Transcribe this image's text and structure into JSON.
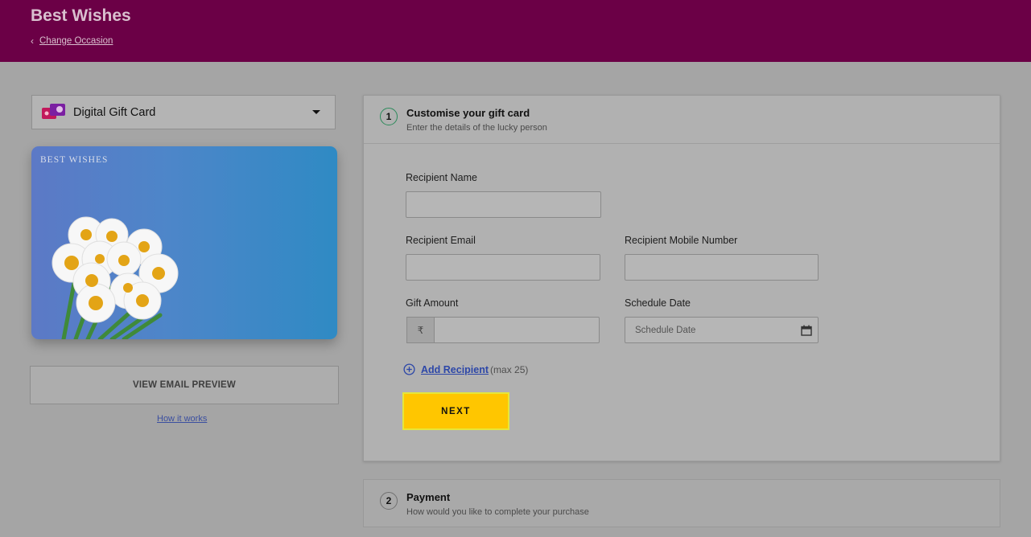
{
  "header": {
    "title": "Best Wishes",
    "back_link": "Change Occasion"
  },
  "card_selector": {
    "selected": "Digital Gift Card"
  },
  "card_preview": {
    "text": "BEST WISHES"
  },
  "left_actions": {
    "email_preview": "VIEW EMAIL PREVIEW",
    "how_it_works": "How it works"
  },
  "step1": {
    "number": "1",
    "title": "Customise your gift card",
    "subtitle": "Enter the details of the lucky person",
    "fields": {
      "recipient_name": {
        "label": "Recipient Name",
        "value": ""
      },
      "recipient_email": {
        "label": "Recipient Email",
        "value": ""
      },
      "recipient_mobile": {
        "label": "Recipient Mobile Number",
        "value": ""
      },
      "gift_amount": {
        "label": "Gift Amount",
        "currency": "₹",
        "value": ""
      },
      "schedule_date": {
        "label": "Schedule Date",
        "placeholder": "Schedule Date"
      }
    },
    "add_recipient": {
      "label": "Add Recipient",
      "note": "(max 25)"
    },
    "next_label": "NEXT"
  },
  "step2": {
    "number": "2",
    "title": "Payment",
    "subtitle": "How would you like to complete your purchase"
  },
  "colors": {
    "header_bg": "#6b0046",
    "next_button": "#ffc600",
    "link": "#2d47a8"
  }
}
